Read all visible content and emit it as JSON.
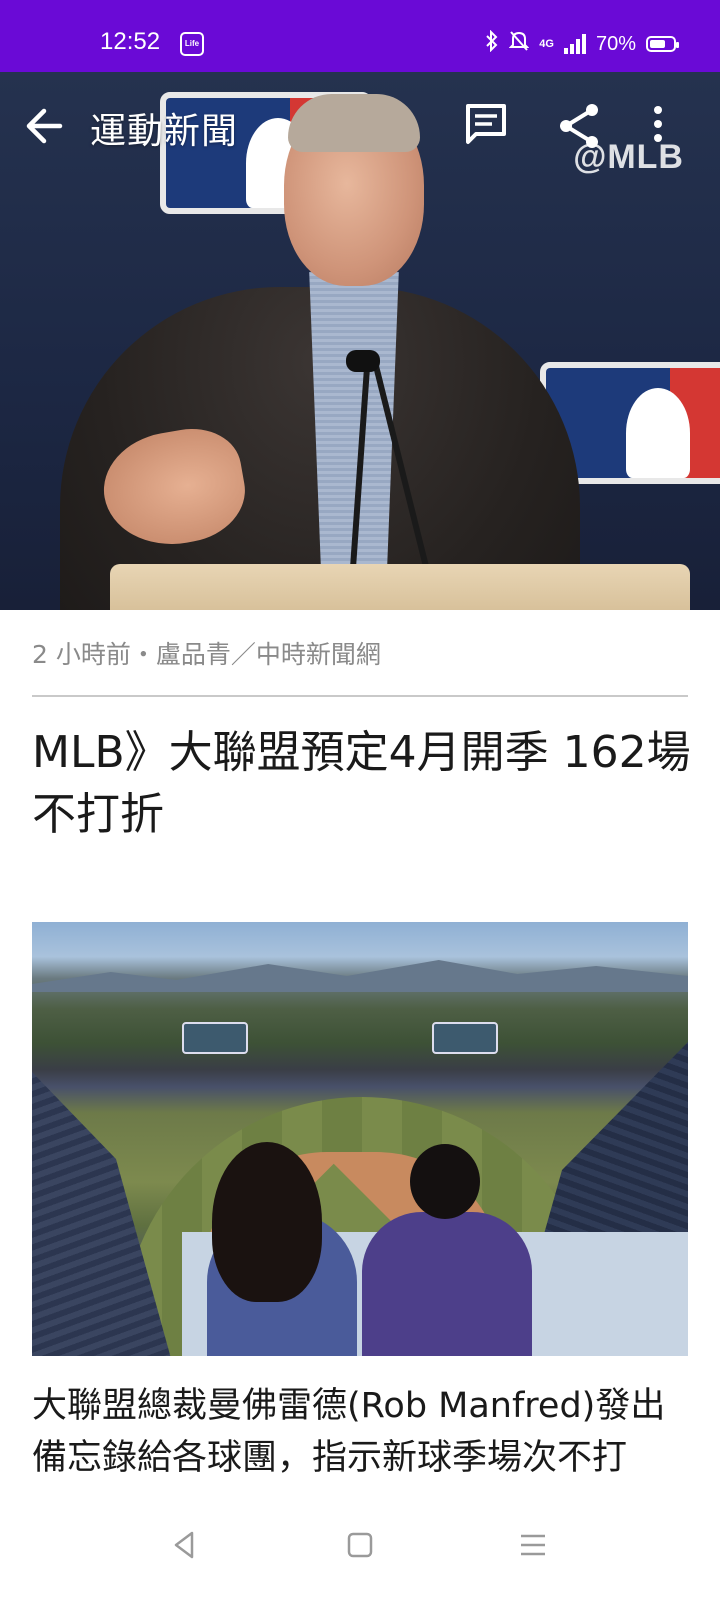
{
  "status_bar": {
    "time": "12:52",
    "app_icon_label": "Life",
    "network": "4G",
    "battery": "70%",
    "battery_level": 0.7
  },
  "header": {
    "title": "運動新聞",
    "watermark": "@MLB"
  },
  "article": {
    "meta": "2 小時前・盧品青／中時新聞網",
    "headline": "MLB》大聯盟預定4月開季 162場不打折",
    "body": "大聯盟總裁曼佛雷德(Rob Manfred)發出備忘錄給各球團，指示新球季場次不打"
  },
  "colors": {
    "status_bar": "#6a0ad6",
    "meta_text": "#8a8a8a",
    "headline_text": "#1a1a1a"
  },
  "icons": {
    "back": "arrow-left-icon",
    "comments": "comment-icon",
    "share": "share-icon",
    "more": "more-vertical-icon",
    "nav_back": "nav-back-icon",
    "nav_home": "nav-home-icon",
    "nav_menu": "nav-menu-icon"
  }
}
